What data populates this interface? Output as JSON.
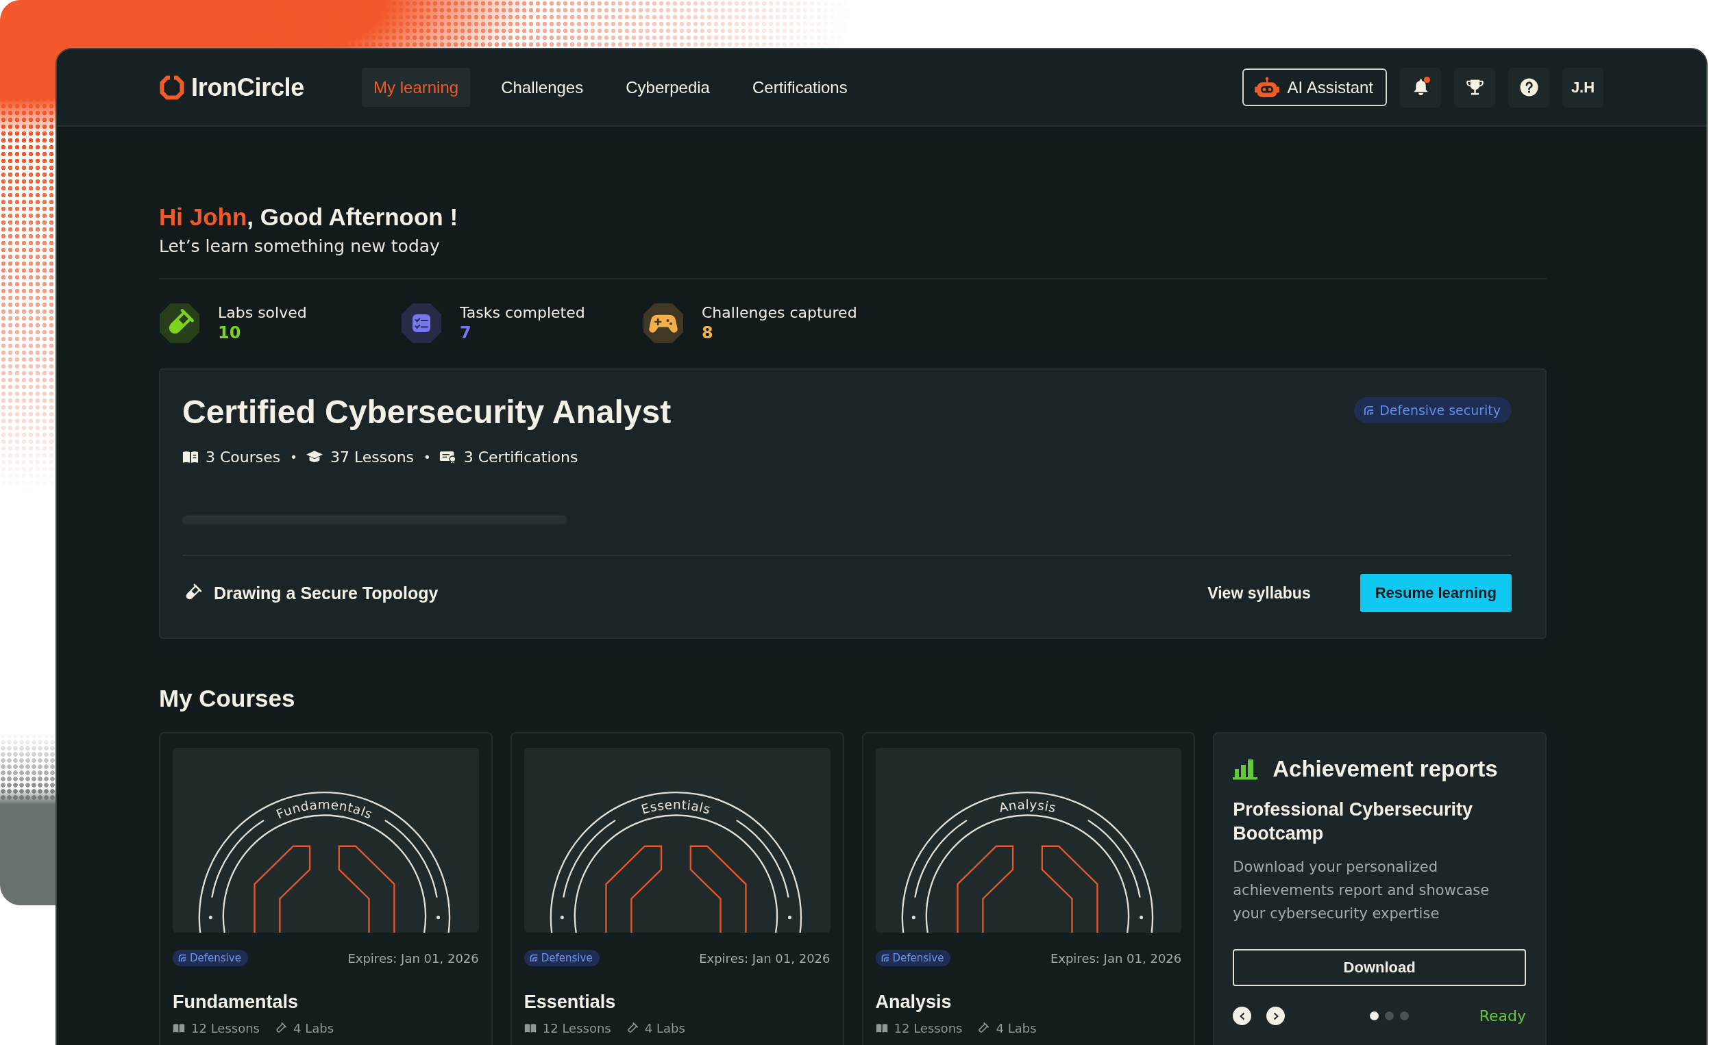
{
  "nav": {
    "logo": "IronCircle",
    "tabs": [
      {
        "label": "My learning",
        "selected": true
      },
      {
        "label": "Challenges",
        "selected": false
      },
      {
        "label": "Cyberpedia",
        "selected": false
      },
      {
        "label": "Certifications",
        "selected": false
      }
    ],
    "assistant": "AI Assistant",
    "notifications": {
      "unread": true
    },
    "avatar": "J.H"
  },
  "greeting": {
    "name": "Hi John",
    "rest": ", Good Afternoon !",
    "subtitle": "Let’s learn something new today"
  },
  "stats": [
    {
      "kind": "labs",
      "label": "Labs solved",
      "value": "10",
      "color": "#7ed321"
    },
    {
      "kind": "tasks",
      "label": "Tasks completed",
      "value": "7",
      "color": "#7776ee"
    },
    {
      "kind": "challenges",
      "label": "Challenges captured",
      "value": "8",
      "color": "#f2b04c"
    }
  ],
  "certification": {
    "title": "Certified Cybersecurity Analyst",
    "tag": "Defensive security",
    "meta": [
      {
        "kind": "courses",
        "text": "3 Courses",
        "separator": "•"
      },
      {
        "kind": "lessons",
        "text": "37 Lessons",
        "separator": "•"
      },
      {
        "kind": "certifications",
        "text": "3 Certifications"
      }
    ],
    "current_lesson": "Drawing a Secure Topology",
    "secondary_action": "View syllabus",
    "primary_action": "Resume learning"
  },
  "courses": {
    "heading": "My Courses",
    "items": [
      {
        "emblem": "Fundamentals",
        "tag": "Defensive",
        "expires": "Expires: Jan 01, 2026",
        "title": "Fundamentals",
        "lessons": "12 Lessons",
        "labs": "4 Labs"
      },
      {
        "emblem": "Essentials",
        "tag": "Defensive",
        "expires": "Expires: Jan 01, 2026",
        "title": "Essentials",
        "lessons": "12 Lessons",
        "labs": "4 Labs"
      },
      {
        "emblem": "Analysis",
        "tag": "Defensive",
        "expires": "Expires: Jan 01, 2026",
        "title": "Analysis",
        "lessons": "12 Lessons",
        "labs": "4 Labs"
      }
    ]
  },
  "achievement": {
    "title": "Achievement reports",
    "subtitle": "Professional Cybersecurity Bootcamp",
    "description": "Download your personalized achievements report and showcase your cybersecurity expertise",
    "button": "Download",
    "pages": [
      {
        "selected": true
      },
      {
        "selected": false
      },
      {
        "selected": false
      }
    ],
    "status": "Ready"
  }
}
